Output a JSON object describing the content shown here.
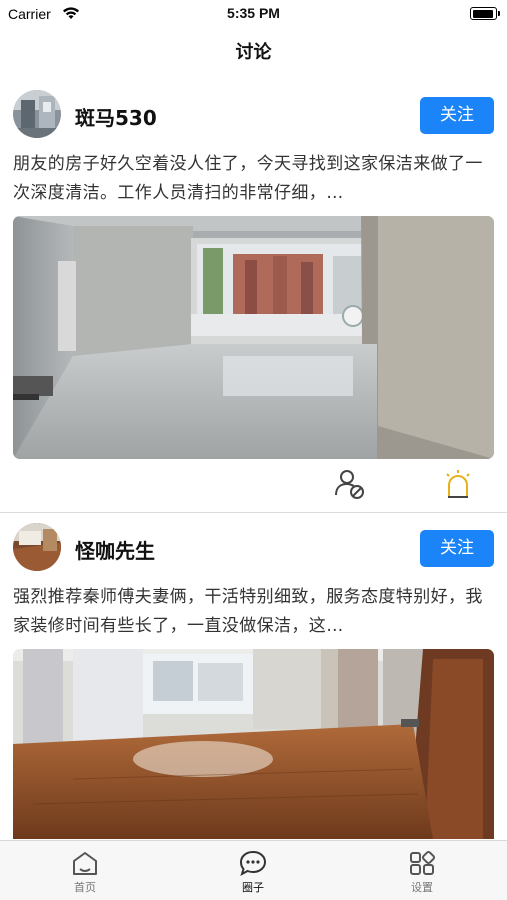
{
  "status_bar": {
    "carrier": "Carrier",
    "time": "5:35 PM"
  },
  "header": {
    "title": "讨论"
  },
  "posts": [
    {
      "username": "斑马530",
      "follow_label": "关注",
      "text": "朋友的房子好久空着没人住了，今天寻找到这家保洁来做了一次深度清洁。工作人员清扫的非常仔细，…"
    },
    {
      "username": "怪咖先生",
      "follow_label": "关注",
      "text": "强烈推荐秦师傅夫妻俩，干活特别细致，服务态度特别好，我家装修时间有些长了，一直没做保洁，这…"
    }
  ],
  "tab_bar": {
    "tabs": [
      {
        "label": "首页",
        "icon": "home-icon"
      },
      {
        "label": "圈子",
        "icon": "chat-bubble-icon"
      },
      {
        "label": "设置",
        "icon": "grid-settings-icon"
      }
    ],
    "active": "圈子"
  },
  "colors": {
    "accent": "#1a84f8",
    "like_icon": "#e5b21c"
  }
}
